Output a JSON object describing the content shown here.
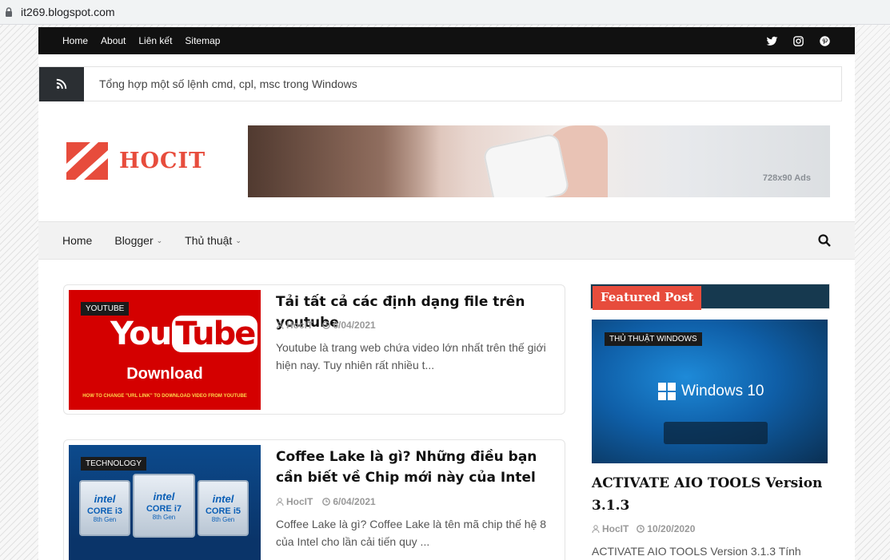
{
  "browser": {
    "url": "it269.blogspot.com"
  },
  "topbar": {
    "links": [
      "Home",
      "About",
      "Liên kết",
      "Sitemap"
    ],
    "social_icons": [
      "twitter-icon",
      "instagram-icon",
      "pinterest-icon"
    ]
  },
  "ticker": {
    "text": "Tổng hợp một số lệnh cmd, cpl, msc trong Windows"
  },
  "header": {
    "brand": "HOCIT",
    "ad_label": "728x90 Ads"
  },
  "nav": {
    "items": [
      {
        "label": "Home",
        "dropdown": false
      },
      {
        "label": "Blogger",
        "dropdown": true
      },
      {
        "label": "Thủ thuật",
        "dropdown": true
      }
    ]
  },
  "posts": [
    {
      "tag": "YOUTUBE",
      "title": "Tải tất cả các định dạng file trên youtube",
      "author": "HocIT",
      "date": "6/04/2021",
      "excerpt": "Youtube là trang web chứa video lớn nhất trên thế giới hiện nay. Tuy nhiên rất nhiều t...",
      "thumb": {
        "word1": "You",
        "word2": "Tube",
        "subtitle": "Download",
        "small": "HOW TO CHANGE \"URL LINK\" TO DOWNLOAD VIDEO FROM YOUTUBE"
      }
    },
    {
      "tag": "TECHNOLOGY",
      "title": "Coffee Lake là gì? Những điều bạn cần biết về Chip mới này của Intel",
      "author": "HocIT",
      "date": "6/04/2021",
      "excerpt": "Coffee Lake là gì? Coffee Lake là tên mã chip thế hệ 8 của Intel cho lần cải tiến quy ...",
      "thumb": {
        "brand": "intel",
        "chips": [
          {
            "core": "CORE i3",
            "gen": "8th Gen"
          },
          {
            "core": "CORE i7",
            "gen": "8th Gen"
          },
          {
            "core": "CORE i5",
            "gen": "8th Gen"
          }
        ]
      }
    }
  ],
  "sidebar": {
    "featured_label": "Featured Post",
    "tag": "THỦ THUẬT WINDOWS",
    "image_text": "Windows 10",
    "title": "ACTIVATE AIO TOOLS Version 3.1.3",
    "author": "HocIT",
    "date": "10/20/2020",
    "excerpt": "ACTIVATE AIO TOOLS Version 3.1.3  Tính"
  },
  "colors": {
    "accent": "#e74c3c",
    "topbar": "#111111",
    "featured_bar": "#16394f"
  }
}
